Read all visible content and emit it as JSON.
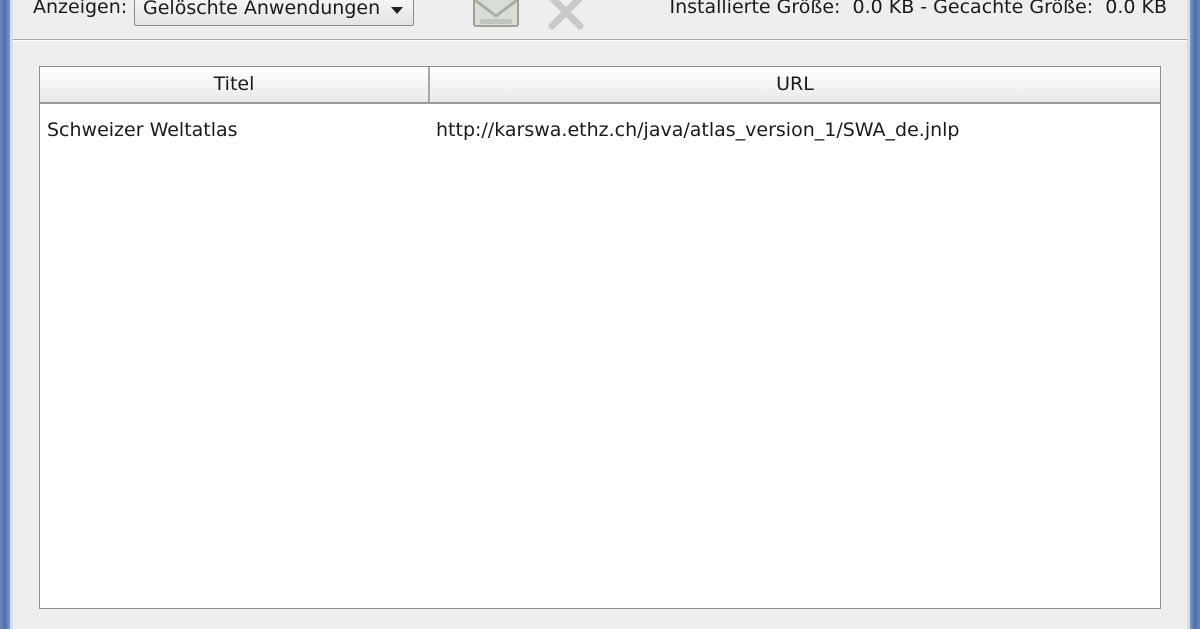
{
  "toolbar": {
    "show_label": "Anzeigen:",
    "show_value": "Gelöschte Anwendungen",
    "install_icon": "install-shortcut-icon",
    "delete_icon": "delete-x-icon",
    "size_info": "Installierte Größe:  0.0 KB - Gecachte Größe:  0.0 KB"
  },
  "table": {
    "columns": [
      "Titel",
      "URL"
    ],
    "rows": [
      {
        "title": "Schweizer Weltatlas",
        "url": "http://karswa.ethz.ch/java/atlas_version_1/SWA_de.jnlp"
      }
    ]
  }
}
